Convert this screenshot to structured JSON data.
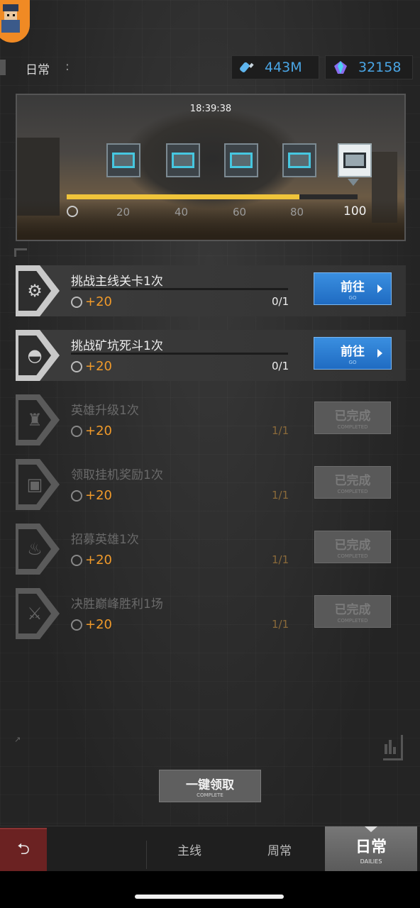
{
  "header": {
    "title": "日常",
    "colon": ":"
  },
  "currencies": [
    {
      "icon": "bottle-icon",
      "value": "443M"
    },
    {
      "icon": "gem-icon",
      "value": "32158"
    }
  ],
  "banner": {
    "timer": "18:39:38",
    "progress_fraction": 0.8,
    "milestones": [
      "20",
      "40",
      "60",
      "80",
      "100"
    ]
  },
  "tasks": [
    {
      "name": "挑战主线关卡1次",
      "reward": "+20",
      "count": "0/1",
      "status": "active",
      "icon": "robot-icon",
      "button": "前往",
      "button_sub": "GO"
    },
    {
      "name": "挑战矿坑死斗1次",
      "reward": "+20",
      "count": "0/1",
      "status": "active",
      "icon": "helmet-icon",
      "button": "前往",
      "button_sub": "GO"
    },
    {
      "name": "英雄升级1次",
      "reward": "+20",
      "count": "1/1",
      "status": "done",
      "icon": "spartan-helmet-icon",
      "button": "已完成",
      "button_sub": "COMPLETED"
    },
    {
      "name": "领取挂机奖励1次",
      "reward": "+20",
      "count": "1/1",
      "status": "done",
      "icon": "treasure-chest-icon",
      "button": "已完成",
      "button_sub": "COMPLETED"
    },
    {
      "name": "招募英雄1次",
      "reward": "+20",
      "count": "1/1",
      "status": "done",
      "icon": "summon-icon",
      "button": "已完成",
      "button_sub": "COMPLETED"
    },
    {
      "name": "决胜巅峰胜利1场",
      "reward": "+20",
      "count": "1/1",
      "status": "done",
      "icon": "crossed-swords-icon",
      "button": "已完成",
      "button_sub": "COMPLETED"
    }
  ],
  "claim_all": {
    "label": "一键领取",
    "sub": "COMPLETE"
  },
  "bottom_nav": {
    "back_icon": "return-icon",
    "tabs": [
      "主线",
      "周常"
    ],
    "active": {
      "label": "日常",
      "sub": "DAILIES"
    }
  },
  "colors": {
    "accent_blue": "#2f7fd6",
    "progress_yellow": "#f0c43a",
    "reward_orange": "#f09a2a",
    "currency_blue": "#4aa6e6"
  }
}
